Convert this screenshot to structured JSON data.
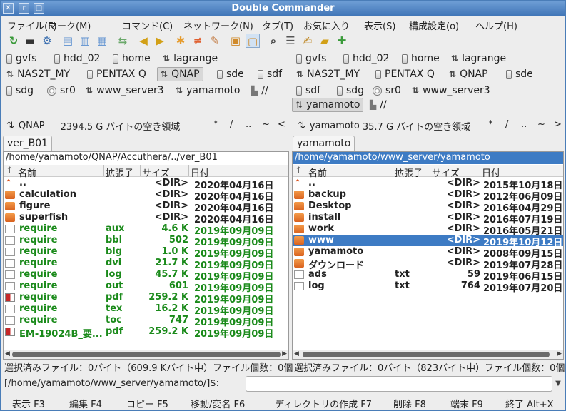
{
  "window": {
    "title": "Double Commander"
  },
  "menu": [
    "ファイル(F)",
    "マーク(M)",
    "コマンド(C)",
    "ネットワーク(N)",
    "タブ(T)",
    "お気に入り",
    "表示(S)",
    "構成設定(o)",
    "ヘルプ(H)"
  ],
  "toolbar": [
    {
      "icon": "refresh-icon",
      "color": "#3a9a3a"
    },
    {
      "icon": "terminal-icon",
      "color": "#333333"
    },
    {
      "icon": "options-icon",
      "color": "#3b6fb0"
    },
    {
      "icon": "brief-view-icon",
      "color": "#5b8fd0"
    },
    {
      "icon": "full-view-icon",
      "color": "#5b8fd0"
    },
    {
      "icon": "thumbnail-view-icon",
      "color": "#5b8fd0"
    },
    {
      "icon": "sync-dirs-icon",
      "color": "#6aa86a"
    },
    {
      "icon": "copy-left-icon",
      "color": "#d2a017"
    },
    {
      "icon": "copy-right-icon",
      "color": "#d2a017"
    },
    {
      "icon": "multi-rename-icon",
      "color": "#e69b2c"
    },
    {
      "icon": "compare-icon",
      "color": "#e06030"
    },
    {
      "icon": "edit-icon",
      "color": "#c0753a"
    },
    {
      "icon": "pack-icon",
      "color": "#d08a2a"
    },
    {
      "icon": "unpack-icon",
      "color": "#d08a2a"
    },
    {
      "icon": "search-icon",
      "color": "#444444"
    },
    {
      "icon": "view-icon",
      "color": "#555555"
    },
    {
      "icon": "edit-doc-icon",
      "color": "#c08a2a"
    },
    {
      "icon": "new-folder-icon",
      "color": "#d2a017"
    },
    {
      "icon": "copy-names-icon",
      "color": "#3a9a3a"
    }
  ],
  "left": {
    "drives": [
      {
        "label": "gvfs",
        "icon": "disk-icon"
      },
      {
        "label": "hdd_02",
        "icon": "disk-icon"
      },
      {
        "label": "home",
        "icon": "disk-icon"
      },
      {
        "label": "lagrange",
        "icon": "network-icon"
      },
      {
        "label": "NAS2T_MY",
        "icon": "network-icon"
      },
      {
        "label": "PENTAX Q",
        "icon": "disk-icon"
      },
      {
        "label": "QNAP",
        "icon": "network-icon",
        "selected": true
      },
      {
        "label": "sde",
        "icon": "disk-icon"
      },
      {
        "label": "sdf",
        "icon": "disk-icon"
      },
      {
        "label": "sdg",
        "icon": "disk-icon"
      },
      {
        "label": "sr0",
        "icon": "cdrom-icon"
      },
      {
        "label": "www_server3",
        "icon": "network-icon"
      },
      {
        "label": "yamamoto",
        "icon": "network-icon"
      },
      {
        "label": "//",
        "icon": "root-icon"
      }
    ],
    "info": {
      "drive": "QNAP",
      "free": "2394.5 G バイトの空き領域",
      "nav": [
        "*",
        "/",
        "..",
        "~",
        "<"
      ]
    },
    "tab": "ver_B01",
    "path": "/home/yamamoto/QNAP/Accuthera/../ver_B01",
    "columns": [
      "名前",
      "拡張子",
      "サイズ",
      "日付"
    ],
    "rows": [
      {
        "name": "..",
        "ext": "",
        "size": "<DIR>",
        "date": "2020年04月16日",
        "type": "up"
      },
      {
        "name": "calculation",
        "ext": "",
        "size": "<DIR>",
        "date": "2020年04月16日",
        "type": "folder"
      },
      {
        "name": "figure",
        "ext": "",
        "size": "<DIR>",
        "date": "2020年04月16日",
        "type": "folder"
      },
      {
        "name": "superfish",
        "ext": "",
        "size": "<DIR>",
        "date": "2020年04月16日",
        "type": "folder"
      },
      {
        "name": "require",
        "ext": "aux",
        "size": "4.6 K",
        "date": "2019年09月09日",
        "type": "file"
      },
      {
        "name": "require",
        "ext": "bbl",
        "size": "502",
        "date": "2019年09月09日",
        "type": "file"
      },
      {
        "name": "require",
        "ext": "blg",
        "size": "1.0 K",
        "date": "2019年09月09日",
        "type": "file"
      },
      {
        "name": "require",
        "ext": "dvi",
        "size": "21.7 K",
        "date": "2019年09月09日",
        "type": "file"
      },
      {
        "name": "require",
        "ext": "log",
        "size": "45.7 K",
        "date": "2019年09月09日",
        "type": "file"
      },
      {
        "name": "require",
        "ext": "out",
        "size": "601",
        "date": "2019年09月09日",
        "type": "file"
      },
      {
        "name": "require",
        "ext": "pdf",
        "size": "259.2 K",
        "date": "2019年09月09日",
        "type": "pdf"
      },
      {
        "name": "require",
        "ext": "tex",
        "size": "16.2 K",
        "date": "2019年09月09日",
        "type": "file"
      },
      {
        "name": "require",
        "ext": "toc",
        "size": "747",
        "date": "2019年09月09日",
        "type": "file"
      },
      {
        "name": "EM-19024B_要...",
        "ext": "pdf",
        "size": "259.2 K",
        "date": "2019年09月09日",
        "type": "pdf"
      }
    ],
    "status": "選択済みファイル：0バイト（609.9 Kバイト中）ファイル個数：0個"
  },
  "right": {
    "drives": [
      {
        "label": "gvfs",
        "icon": "disk-icon"
      },
      {
        "label": "hdd_02",
        "icon": "disk-icon"
      },
      {
        "label": "home",
        "icon": "disk-icon"
      },
      {
        "label": "lagrange",
        "icon": "network-icon"
      },
      {
        "label": "NAS2T_MY",
        "icon": "network-icon"
      },
      {
        "label": "PENTAX Q",
        "icon": "disk-icon"
      },
      {
        "label": "QNAP",
        "icon": "network-icon"
      },
      {
        "label": "sde",
        "icon": "disk-icon"
      },
      {
        "label": "sdf",
        "icon": "disk-icon"
      },
      {
        "label": "sdg",
        "icon": "disk-icon"
      },
      {
        "label": "sr0",
        "icon": "cdrom-icon"
      },
      {
        "label": "www_server3",
        "icon": "network-icon"
      },
      {
        "label": "yamamoto",
        "icon": "network-icon",
        "selected": true
      },
      {
        "label": "//",
        "icon": "root-icon"
      }
    ],
    "info": {
      "drive": "yamamoto",
      "free": "35.7 G バイトの空き領域",
      "nav": [
        "*",
        "/",
        "..",
        "~",
        ">"
      ]
    },
    "tab": "yamamoto",
    "path": "/home/yamamoto/www_server/yamamoto",
    "columns": [
      "名前",
      "拡張子",
      "サイズ",
      "日付"
    ],
    "rows": [
      {
        "name": "..",
        "ext": "",
        "size": "<DIR>",
        "date": "2015年10月18日",
        "type": "up"
      },
      {
        "name": "backup",
        "ext": "",
        "size": "<DIR>",
        "date": "2012年06月09日",
        "type": "folder"
      },
      {
        "name": "Desktop",
        "ext": "",
        "size": "<DIR>",
        "date": "2016年04月29日",
        "type": "folder"
      },
      {
        "name": "install",
        "ext": "",
        "size": "<DIR>",
        "date": "2016年07月19日",
        "type": "folder"
      },
      {
        "name": "work",
        "ext": "",
        "size": "<DIR>",
        "date": "2016年05月21日",
        "type": "folder"
      },
      {
        "name": "www",
        "ext": "",
        "size": "<DIR>",
        "date": "2019年10月12日",
        "type": "folder",
        "cursor": true
      },
      {
        "name": "yamamoto",
        "ext": "",
        "size": "<DIR>",
        "date": "2008年09月15日",
        "type": "folder"
      },
      {
        "name": "ダウンロード",
        "ext": "",
        "size": "<DIR>",
        "date": "2019年07月28日",
        "type": "folder"
      },
      {
        "name": "ads",
        "ext": "txt",
        "size": "59",
        "date": "2019年06月15日",
        "type": "file"
      },
      {
        "name": "log",
        "ext": "txt",
        "size": "764",
        "date": "2019年07月20日",
        "type": "file"
      }
    ],
    "status": "選択済みファイル：0バイト（823バイト中）ファイル個数：0個"
  },
  "cmdline": {
    "label": "[/home/yamamoto/www_server/yamamoto/]$:",
    "value": ""
  },
  "fkeys": [
    "表示 F3",
    "編集 F4",
    "コピー F5",
    "移動/変名 F6",
    "ディレクトリの作成 F7",
    "削除 F8",
    "端末 F9",
    "終了 Alt+X"
  ],
  "colors": {
    "title": "#3f74b6",
    "selection": "#3d7bc4",
    "exec": "#1a8a1a",
    "folder": "#e07a2e"
  }
}
